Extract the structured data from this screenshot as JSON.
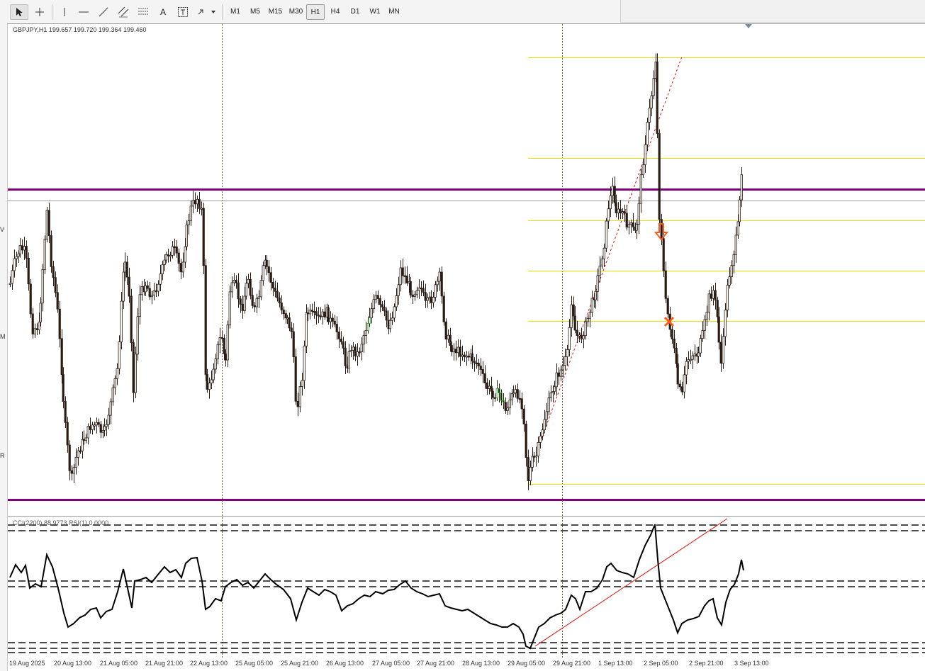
{
  "toolbar": {
    "tools": [
      "cursor-icon",
      "crosshair-icon",
      "vertical-line-icon",
      "horizontal-line-icon",
      "trendline-icon",
      "equidistant-channel-icon",
      "fibonacci-icon",
      "text-icon",
      "text-label-icon",
      "shapes-dropdown-icon"
    ],
    "text_tool_label": "A",
    "timeframes": [
      "M1",
      "M5",
      "M15",
      "M30",
      "H1",
      "H4",
      "D1",
      "W1",
      "MN"
    ],
    "active_timeframe": "H1"
  },
  "chart": {
    "symbol_line": "GBPJPY,H1  199.657 199.720 199.364 199.460",
    "indicator_line": "CCI(2200) 88.9773  RSI(1) 0.0000",
    "left_edge_marks": [
      "V",
      "M",
      "R"
    ],
    "x_labels": [
      "19 Aug 2025",
      "20 Aug 13:00",
      "21 Aug 05:00",
      "21 Aug 21:00",
      "22 Aug 13:00",
      "25 Aug 05:00",
      "25 Aug 21:00",
      "26 Aug 13:00",
      "27 Aug 05:00",
      "27 Aug 21:00",
      "28 Aug 13:00",
      "29 Aug 05:00",
      "29 Aug 21:00",
      "1 Sep 13:00",
      "2 Sep 05:00",
      "2 Sep 21:00",
      "3 Sep 13:00"
    ],
    "colors": {
      "resistance": "#800080",
      "fib_levels": "#e8e000",
      "candle": "#2a1c14",
      "bull_accent": "#2ea32e",
      "arrow": "#ff5a1a",
      "trend": "#e01010"
    }
  }
}
